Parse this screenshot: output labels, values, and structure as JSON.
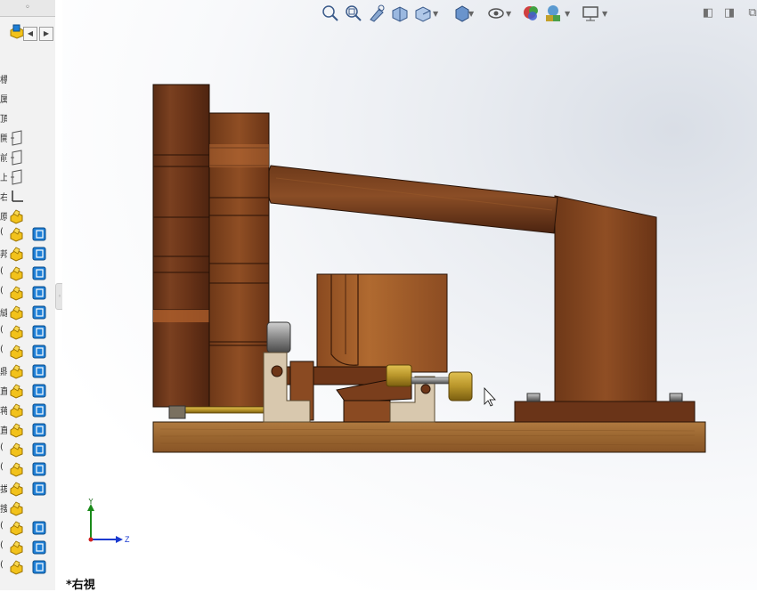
{
  "left_pane": {
    "collapse_glyph": "◦",
    "row_letters": [
      "標",
      "属",
      "頂",
      "開",
      "前",
      "上",
      "右",
      "原",
      "(",
      "邦",
      "(",
      "(",
      "縫",
      "(",
      "(",
      "鼎",
      "直",
      "蒋",
      "直",
      "(",
      "(",
      "拔",
      "搜",
      "(",
      "(",
      "("
    ],
    "has_body_icon": [
      false,
      false,
      false,
      false,
      false,
      false,
      false,
      false,
      true,
      true,
      true,
      true,
      true,
      true,
      true,
      true,
      true,
      true,
      true,
      true,
      true,
      true,
      false,
      true,
      true,
      true
    ]
  },
  "toolbar": {
    "icons": [
      "zoom-to-fit-icon",
      "zoom-to-area-icon",
      "previous-view-icon",
      "section-view-icon",
      "view-orientation-icon",
      "display-style-icon",
      "hide-show-items-icon",
      "edit-appearance-icon",
      "apply-scene-icon",
      "view-settings-icon"
    ],
    "caret": "▼"
  },
  "window": {
    "restore_left": "◧",
    "restore_right": "◨",
    "maximize": "⧉",
    "close": "✕"
  },
  "view_label": "*右視",
  "triad": {
    "y_label": "Y",
    "z_label": "Z"
  },
  "colors": {
    "wood_dark": "#6b3519",
    "wood_mid": "#8a4a22",
    "wood_light": "#b0703c",
    "base_wood": "#a06a36",
    "bracket": "#d8c8ae",
    "brass": "#b8952a",
    "icon_yellow": "#f2c21b",
    "icon_blue": "#1e7fd6"
  }
}
